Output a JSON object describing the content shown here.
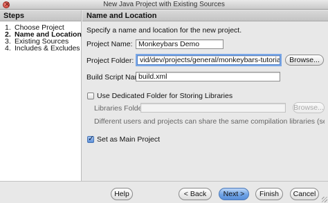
{
  "window": {
    "title": "New Java Project with Existing Sources"
  },
  "steps": {
    "header": "Steps",
    "items": [
      {
        "num": "1.",
        "label": "Choose Project"
      },
      {
        "num": "2.",
        "label": "Name and Location"
      },
      {
        "num": "3.",
        "label": "Existing Sources"
      },
      {
        "num": "4.",
        "label": "Includes & Excludes"
      }
    ],
    "active_index": 1
  },
  "panel": {
    "header": "Name and Location",
    "instructions": "Specify a name and location for the new project.",
    "project_name": {
      "label": "Project Name:",
      "value": "Monkeybars Demo"
    },
    "project_folder": {
      "label": "Project Folder:",
      "value": "vid/dev/projects/general/monkeybars-tutorial/demo",
      "browse_label": "Browse..."
    },
    "build_script": {
      "label": "Build Script Name:",
      "value": "build.xml"
    },
    "dedicated_folder": {
      "label": "Use Dedicated Folder for Storing Libraries",
      "checked": false
    },
    "libraries_folder": {
      "label": "Libraries Folder:",
      "value": "",
      "browse_label": "Browse..."
    },
    "libraries_hint": "Different users and projects can share the same compilation libraries (see Help for detail",
    "main_project": {
      "label": "Set as Main Project",
      "checked": true
    }
  },
  "footer": {
    "help": "Help",
    "back": "< Back",
    "next": "Next >",
    "finish": "Finish",
    "cancel": "Cancel"
  }
}
